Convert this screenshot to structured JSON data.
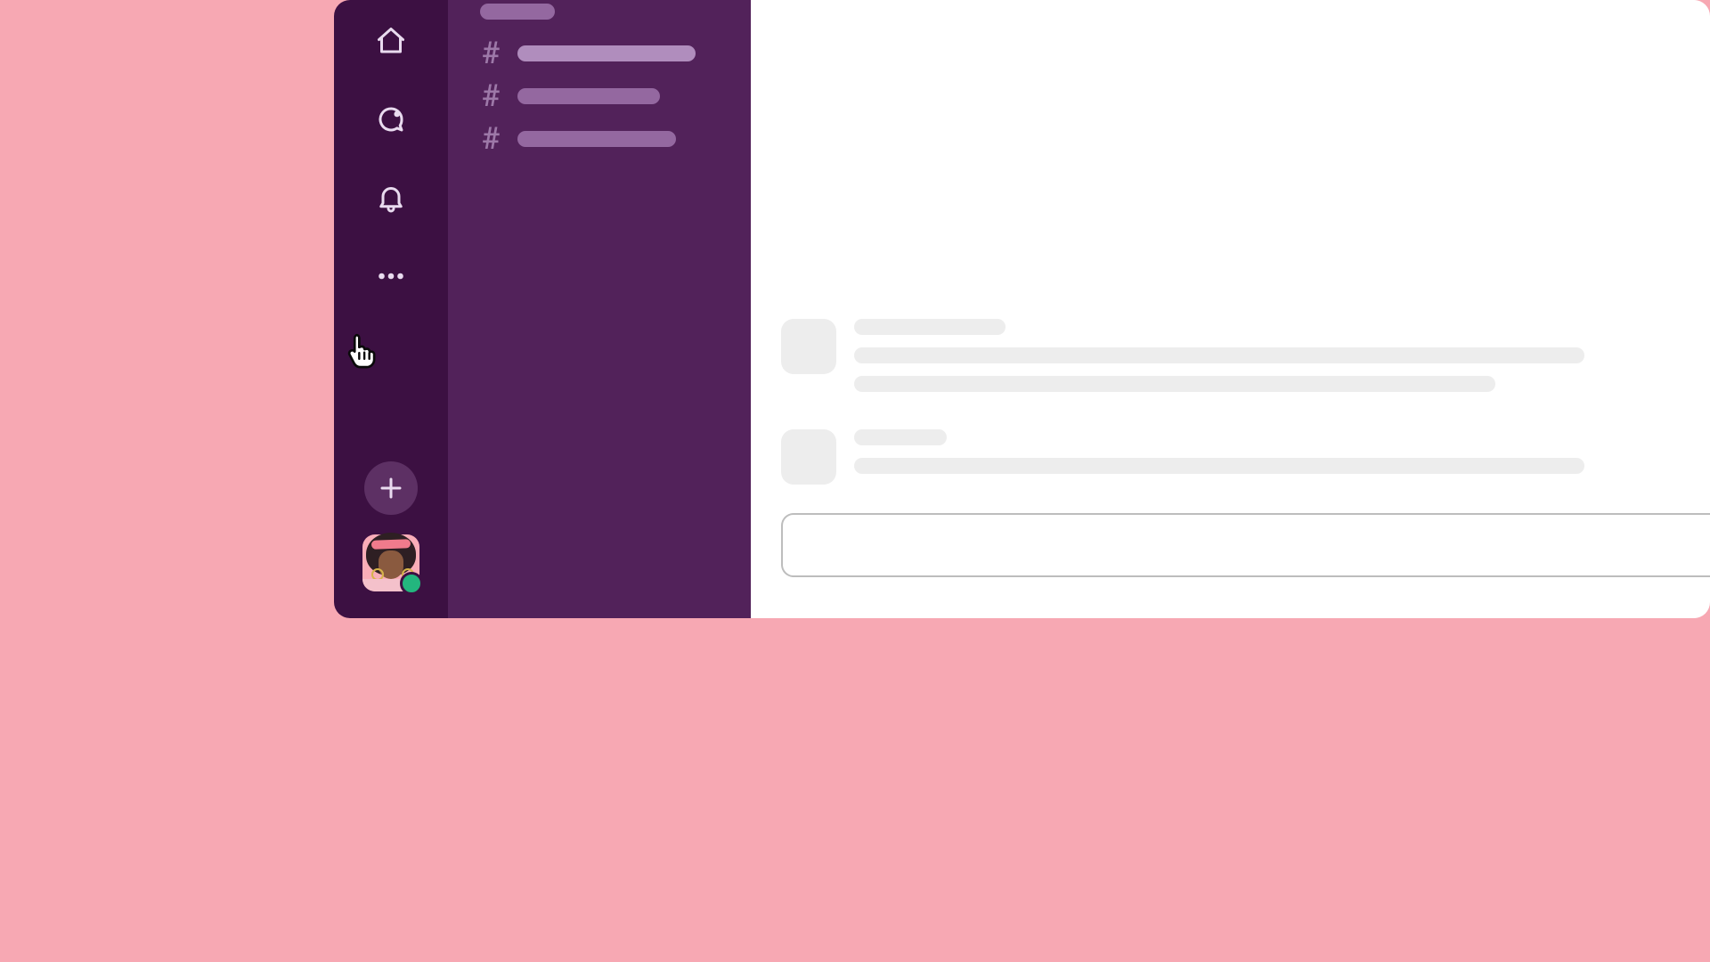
{
  "colors": {
    "page_bg": "#f7a8b3",
    "rail_bg": "#3c1042",
    "channels_bg": "#52225a",
    "main_bg": "#ffffff",
    "online": "#23b67e"
  },
  "rail": {
    "items": [
      {
        "name": "home",
        "icon": "home-icon"
      },
      {
        "name": "dms",
        "icon": "dm-icon"
      },
      {
        "name": "activity",
        "icon": "bell-icon"
      },
      {
        "name": "more",
        "icon": "ellipsis-icon"
      }
    ],
    "add_label": "",
    "user": {
      "presence": "online"
    }
  },
  "channels": {
    "section_label": "",
    "items": [
      {
        "hash": "#",
        "selected": true,
        "width_hint": "long"
      },
      {
        "hash": "#",
        "selected": false,
        "width_hint": "medium"
      },
      {
        "hash": "#",
        "selected": false,
        "width_hint": "medium2"
      }
    ]
  },
  "messages": [
    {
      "name_placeholder": "",
      "body_lines": 2
    },
    {
      "name_placeholder": "",
      "body_lines": 1
    }
  ],
  "composer": {
    "placeholder": ""
  },
  "cursor": {
    "kind": "pointing-hand"
  }
}
